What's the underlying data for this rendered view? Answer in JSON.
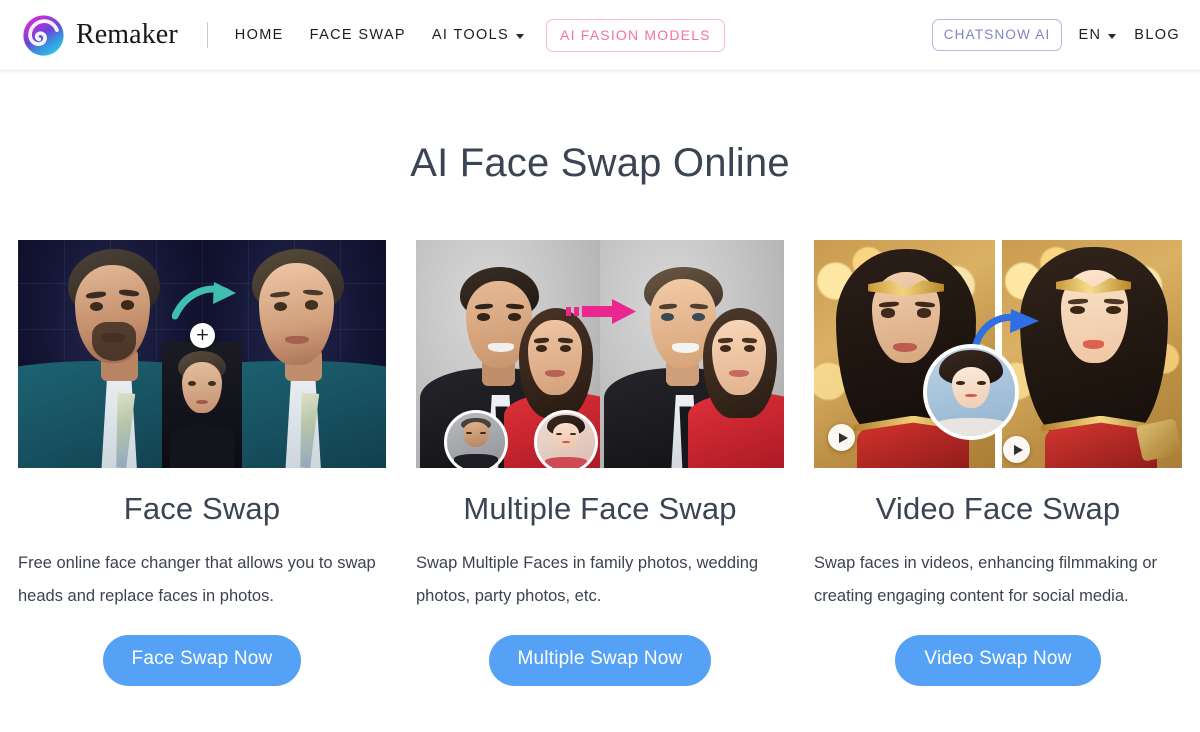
{
  "header": {
    "brand": {
      "name": "Remaker",
      "logo_icon": "remaker-spiral-logo",
      "colors": [
        "#c733c7",
        "#7b3fd4",
        "#3aa7e0",
        "#2ec8e6"
      ]
    },
    "nav": [
      {
        "label": "HOME",
        "type": "link"
      },
      {
        "label": "FACE SWAP",
        "type": "link"
      },
      {
        "label": "AI TOOLS",
        "type": "dropdown"
      },
      {
        "label": "AI FASION MODELS",
        "type": "pill",
        "color": "#f472a0",
        "border_color": "#f9b9cf"
      }
    ],
    "nav_right": [
      {
        "label": "CHATSNOW AI",
        "type": "pill",
        "color": "#8083c7",
        "border_color": "#b6b8e0"
      },
      {
        "label": "EN",
        "type": "dropdown"
      },
      {
        "label": "BLOG",
        "type": "link"
      }
    ]
  },
  "main": {
    "title": "AI Face Swap Online",
    "title_color": "#3b4453",
    "cta_color": "#55a1f5",
    "cards": [
      {
        "title": "Face Swap",
        "desc": "Free online face changer that allows you to swap heads and replace faces in photos.",
        "cta": "Face Swap Now",
        "image": {
          "alt": "Face swap before and after demo with two male portraits in teal suits on a dark blue tech background",
          "arrow_color": "#3fbfb0",
          "arrow_icon": "curved-arrow-right-icon",
          "badge_icon": "plus-circle-icon",
          "badge_label": "+",
          "background": "#141534"
        }
      },
      {
        "title": "Multiple Face Swap",
        "desc": "Swap Multiple Faces in family photos, wedding photos, party photos, etc.",
        "cta": "Multiple Swap Now",
        "image": {
          "alt": "Multiple face swap demo, couple in black suit and red dress on gray studio background",
          "arrow_color": "#ec268f",
          "arrow_icon": "dashed-arrow-right-icon",
          "thumb_count": 2,
          "background": "#c3c3c3"
        }
      },
      {
        "title": "Video Face Swap",
        "desc": "Swap faces in videos, enhancing filmmaking or creating engaging content for social media.",
        "cta": "Video Swap Now",
        "image": {
          "alt": "Video face swap demo with two superhero portraits in gold tiaras on golden bokeh background",
          "arrow_color": "#2f6fe4",
          "arrow_icon": "curved-arrow-right-icon",
          "play_icon": "play-circle-icon",
          "play_count": 2,
          "background": "#c79b52"
        }
      }
    ]
  }
}
